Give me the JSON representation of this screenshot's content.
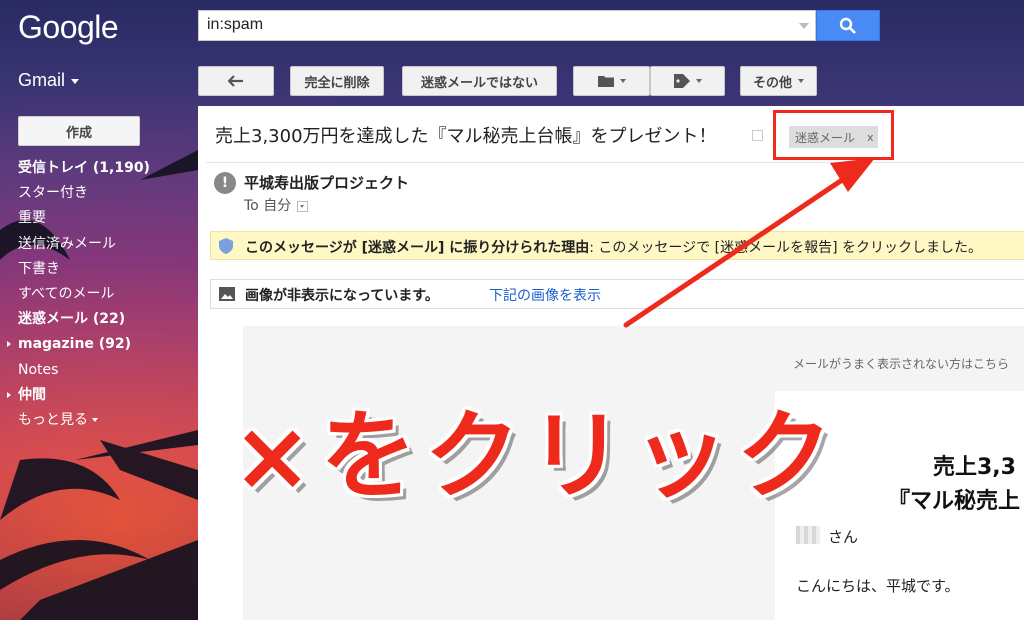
{
  "header": {
    "logo": "Google",
    "search_value": "in:spam"
  },
  "app": {
    "name": "Gmail"
  },
  "toolbar": {
    "delete_forever": "完全に削除",
    "not_spam": "迷惑メールではない",
    "more": "その他"
  },
  "sidebar": {
    "compose": "作成",
    "items": [
      {
        "label": "受信トレイ (1,190)",
        "bold": true
      },
      {
        "label": "スター付き"
      },
      {
        "label": "重要"
      },
      {
        "label": "送信済みメール"
      },
      {
        "label": "下書き"
      },
      {
        "label": "すべてのメール"
      },
      {
        "label": "迷惑メール (22)",
        "bold": true
      },
      {
        "label": "magazine (92)",
        "bold": true
      },
      {
        "label": "Notes"
      },
      {
        "label": "仲間",
        "bold": true
      },
      {
        "label": "もっと見る"
      }
    ]
  },
  "message": {
    "subject": "売上3,300万円を達成した『マル秘売上台帳』をプレゼント！",
    "label": "迷惑メール",
    "label_close": "x",
    "sender": "平城寿出版プロジェクト",
    "to": "To 自分",
    "banner_bold": "このメッセージが [迷惑メール] に振り分けられた理由",
    "banner_rest": ": このメッセージで [迷惑メールを報告] をクリックしました。",
    "images_hidden": "画像が非表示になっています。",
    "images_link": "下記の画像を表示"
  },
  "email_body": {
    "note": "メールがうまく表示されない方はこちら",
    "heading1": "売上3,3",
    "heading2": "『マル秘売上",
    "salutation": "さん",
    "greeting": "こんにちは、平城です。"
  },
  "annotation": {
    "text": "×をクリック",
    "color": "#ee2a1c"
  }
}
